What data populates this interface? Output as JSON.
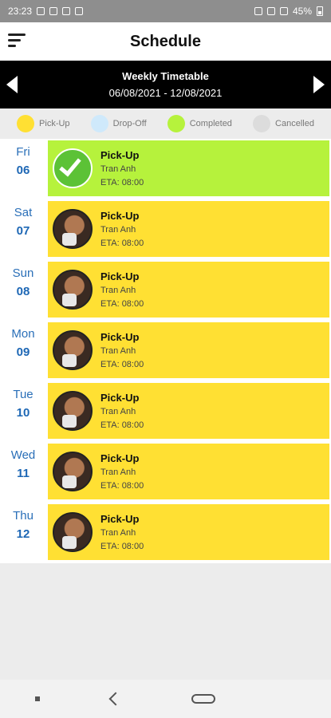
{
  "status_bar": {
    "time": "23:23",
    "battery": "45%"
  },
  "header": {
    "title": "Schedule"
  },
  "week": {
    "title": "Weekly Timetable",
    "range": "06/08/2021 - 12/08/2021"
  },
  "legend": [
    {
      "label": "Pick-Up",
      "color": "#ffe033"
    },
    {
      "label": "Drop-Off",
      "color": "#cfe9fb"
    },
    {
      "label": "Completed",
      "color": "#b6f23c"
    },
    {
      "label": "Cancelled",
      "color": "#dcdcdc"
    }
  ],
  "rows": [
    {
      "day": "Fri",
      "date": "06",
      "type": "Pick-Up",
      "name": "Tran Anh",
      "eta": "ETA: 08:00",
      "status": "completed",
      "color": "#b6f23c"
    },
    {
      "day": "Sat",
      "date": "07",
      "type": "Pick-Up",
      "name": "Tran Anh",
      "eta": "ETA: 08:00",
      "status": "pickup",
      "color": "#ffe033"
    },
    {
      "day": "Sun",
      "date": "08",
      "type": "Pick-Up",
      "name": "Tran Anh",
      "eta": "ETA: 08:00",
      "status": "pickup",
      "color": "#ffe033"
    },
    {
      "day": "Mon",
      "date": "09",
      "type": "Pick-Up",
      "name": "Tran Anh",
      "eta": "ETA: 08:00",
      "status": "pickup",
      "color": "#ffe033"
    },
    {
      "day": "Tue",
      "date": "10",
      "type": "Pick-Up",
      "name": "Tran Anh",
      "eta": "ETA: 08:00",
      "status": "pickup",
      "color": "#ffe033"
    },
    {
      "day": "Wed",
      "date": "11",
      "type": "Pick-Up",
      "name": "Tran Anh",
      "eta": "ETA: 08:00",
      "status": "pickup",
      "color": "#ffe033"
    },
    {
      "day": "Thu",
      "date": "12",
      "type": "Pick-Up",
      "name": "Tran Anh",
      "eta": "ETA: 08:00",
      "status": "pickup",
      "color": "#ffe033"
    }
  ]
}
